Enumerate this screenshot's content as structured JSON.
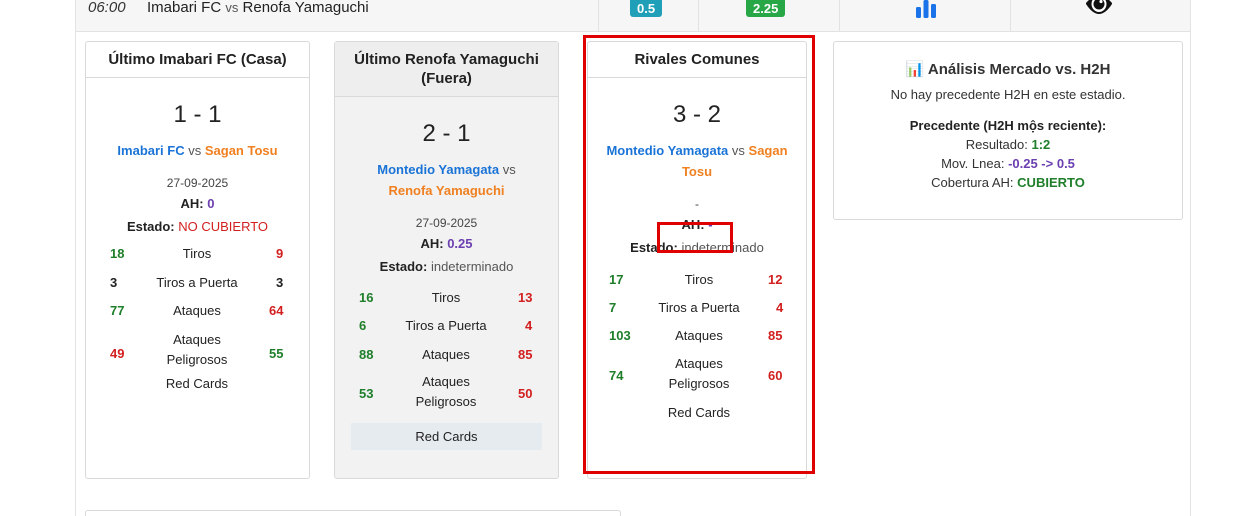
{
  "match": {
    "time": "06:00",
    "home": "Imabari FC",
    "vs": "vs",
    "away": "Renofa Yamaguchi",
    "ah_line": "0.5",
    "goal_line": "2.25"
  },
  "icons": {
    "stats": "bar-chart-icon",
    "view": "eye-icon"
  },
  "colors": {
    "teal": "#1fa0b8",
    "green": "#27a745",
    "home": "#1a73d6",
    "away": "#f08020",
    "purple": "#6a3fb0",
    "red": "#d21f1f",
    "highlight": "#e00000"
  },
  "cards": {
    "home_last": {
      "title": "Último Imabari FC (Casa)",
      "score": "1 - 1",
      "home": "Imabari FC",
      "vs": "vs",
      "away": "Sagan Tosu",
      "date": "27-09-2025",
      "ah_label": "AH:",
      "ah_value": "0",
      "estado_label": "Estado:",
      "estado_value": "NO CUBIERTO",
      "stats": [
        {
          "l": "18",
          "label": "Tiros",
          "r": "9"
        },
        {
          "l": "3",
          "label": "Tiros a Puerta",
          "r": "3"
        },
        {
          "l": "77",
          "label": "Ataques",
          "r": "64"
        },
        {
          "l": "49",
          "label": "Ataques Peligrosos",
          "r": "55"
        },
        {
          "l": "",
          "label": "Red Cards",
          "r": ""
        }
      ]
    },
    "away_last": {
      "title": "Último Renofa Yamaguchi (Fuera)",
      "score": "2 - 1",
      "home": "Montedio Yamagata",
      "vs": "vs",
      "away": "Renofa Yamaguchi",
      "date": "27-09-2025",
      "ah_label": "AH:",
      "ah_value": "0.25",
      "estado_label": "Estado:",
      "estado_value": "indeterminado",
      "stats": [
        {
          "l": "16",
          "label": "Tiros",
          "r": "13"
        },
        {
          "l": "6",
          "label": "Tiros a Puerta",
          "r": "4"
        },
        {
          "l": "88",
          "label": "Ataques",
          "r": "85"
        },
        {
          "l": "53",
          "label": "Ataques Peligrosos",
          "r": "50"
        },
        {
          "l": "",
          "label": "Red Cards",
          "r": ""
        }
      ]
    },
    "common": {
      "title": "Rivales Comunes",
      "score": "3 - 2",
      "home": "Montedio Yamagata",
      "vs": "vs",
      "away": "Sagan Tosu",
      "date": "-",
      "ah_label": "AH:",
      "ah_value": "-",
      "estado_label": "Estado:",
      "estado_value": "indeterminado",
      "stats": [
        {
          "l": "17",
          "label": "Tiros",
          "r": "12"
        },
        {
          "l": "7",
          "label": "Tiros a Puerta",
          "r": "4"
        },
        {
          "l": "103",
          "label": "Ataques",
          "r": "85"
        },
        {
          "l": "74",
          "label": "Ataques Peligrosos",
          "r": "60"
        },
        {
          "l": "",
          "label": "Red Cards",
          "r": ""
        }
      ]
    }
  },
  "market": {
    "icon": "📊",
    "title": "Análisis Mercado vs. H2H",
    "no_precedent": "No hay precedente H2H en este estadio.",
    "precedent_title": "Precedente (H2H mộs reciente):",
    "result_label": "Resultado:",
    "result_value": "1:2",
    "mov_label": "Mov. Lnea:",
    "mov_value": "-0.25 -> 0.5",
    "cov_label": "Cobertura AH:",
    "cov_value": "CUBIERTO"
  }
}
